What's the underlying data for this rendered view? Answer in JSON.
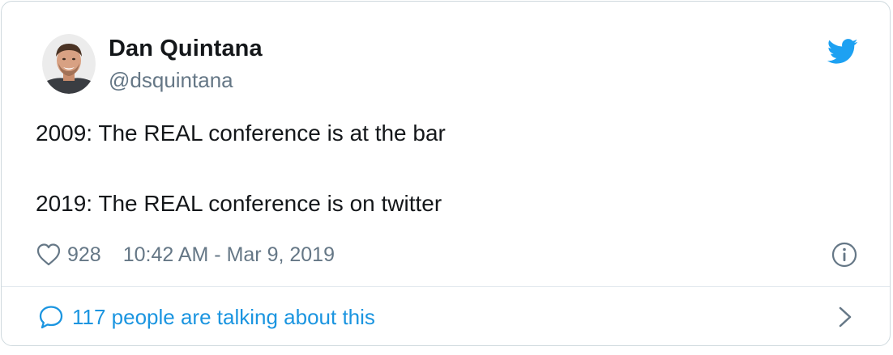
{
  "author": {
    "display_name": "Dan Quintana",
    "handle": "@dsquintana"
  },
  "tweet": {
    "line1": "2009: The REAL conference is at the bar",
    "line2": "2019: The REAL conference is on twitter"
  },
  "meta": {
    "likes": "928",
    "timestamp": "10:42 AM - Mar 9, 2019"
  },
  "conversation": {
    "label": "117 people are talking about this"
  },
  "icons": {
    "brand": "twitter-bird-icon",
    "like": "heart-icon",
    "info": "info-icon",
    "reply": "speech-bubble-icon",
    "more": "chevron-right-icon"
  },
  "colors": {
    "brand": "#1da1f2",
    "link": "#1b95e0",
    "muted": "#657786",
    "text": "#14171a",
    "border": "#cfd9de"
  }
}
